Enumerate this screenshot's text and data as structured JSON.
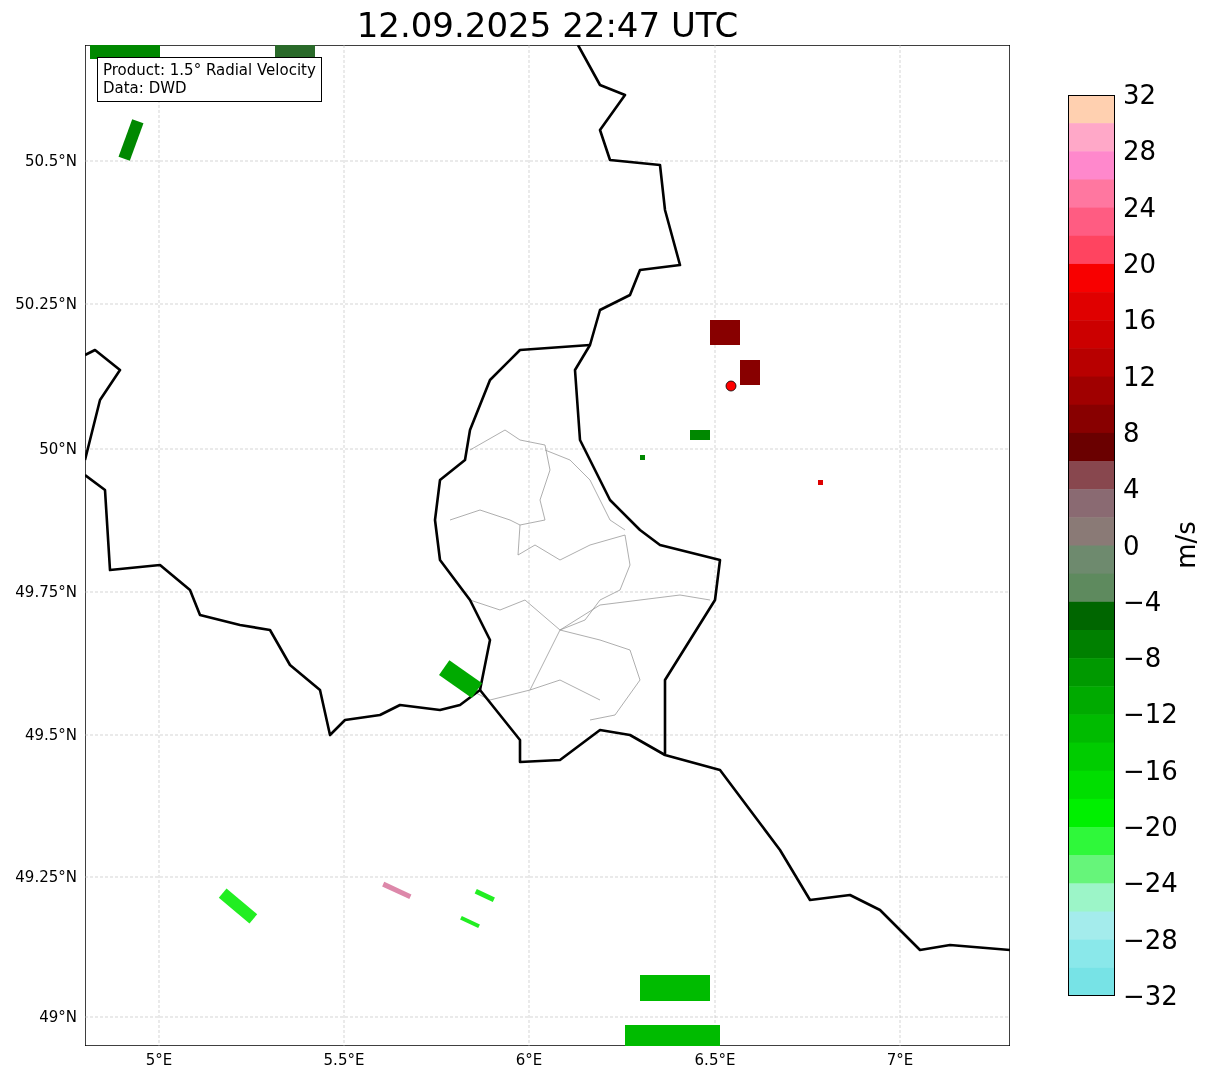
{
  "title": "12.09.2025 22:47 UTC",
  "info_box": {
    "lines": [
      "Product: 1.5° Radial Velocity",
      "Data: DWD"
    ]
  },
  "lat_ticks": [
    "50.5°N",
    "50.25°N",
    "50°N",
    "49.75°N",
    "49.5°N",
    "49.25°N",
    "49°N"
  ],
  "lon_ticks": [
    "5°E",
    "5.5°E",
    "6°E",
    "6.5°E",
    "7°E"
  ],
  "colorbar": {
    "label": "m/s",
    "ticks": [
      "32",
      "28",
      "24",
      "20",
      "16",
      "12",
      "8",
      "4",
      "0",
      "−4",
      "−8",
      "−12",
      "−16",
      "−20",
      "−24",
      "−28",
      "−32"
    ],
    "segments": [
      {
        "color": "#ffd0b0"
      },
      {
        "color": "#ffa8c8"
      },
      {
        "color": "#ff88cc"
      },
      {
        "color": "#ff77a0"
      },
      {
        "color": "#ff5c82"
      },
      {
        "color": "#ff4460"
      },
      {
        "color": "#f80000"
      },
      {
        "color": "#e00000"
      },
      {
        "color": "#cc0000"
      },
      {
        "color": "#b80000"
      },
      {
        "color": "#a00000"
      },
      {
        "color": "#880000"
      },
      {
        "color": "#6a0000"
      },
      {
        "color": "#88474e"
      },
      {
        "color": "#8a6a72"
      },
      {
        "color": "#8a7a76"
      },
      {
        "color": "#6e8a6e"
      },
      {
        "color": "#5e8a5e"
      },
      {
        "color": "#006600"
      },
      {
        "color": "#008000"
      },
      {
        "color": "#009900"
      },
      {
        "color": "#00aa00"
      },
      {
        "color": "#00bb00"
      },
      {
        "color": "#00cc00"
      },
      {
        "color": "#00de00"
      },
      {
        "color": "#00f000"
      },
      {
        "color": "#2ff83a"
      },
      {
        "color": "#66f57a"
      },
      {
        "color": "#9cf5c8"
      },
      {
        "color": "#a4ecec"
      },
      {
        "color": "#8ae8ea"
      },
      {
        "color": "#77e3e6"
      }
    ]
  }
}
